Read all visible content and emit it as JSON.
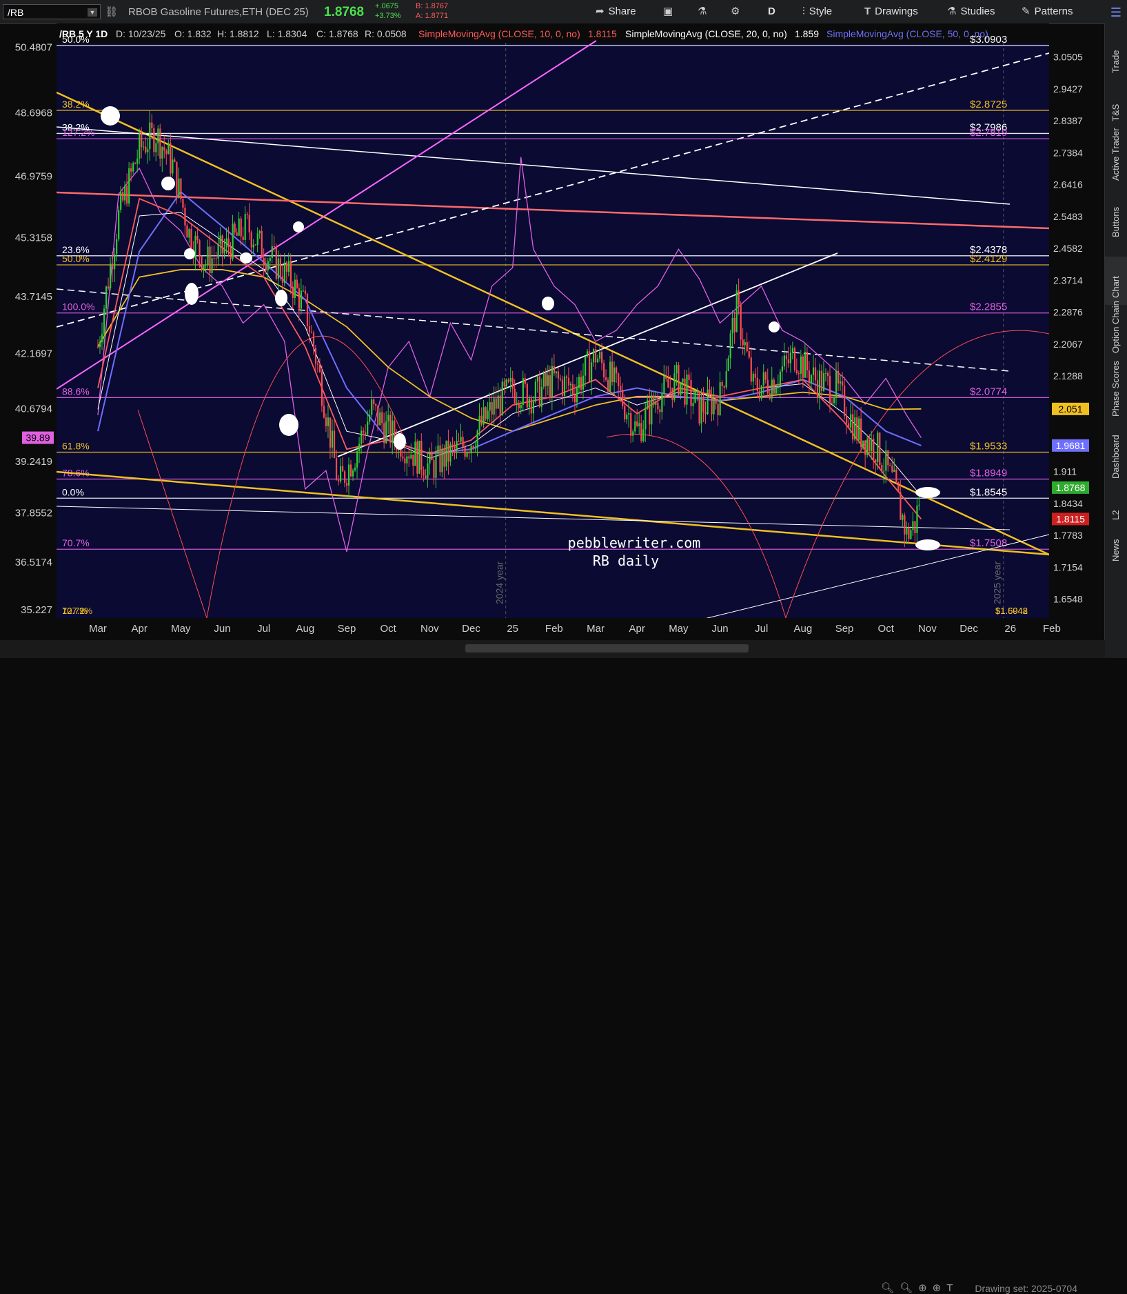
{
  "toolbar": {
    "symbol": "/RB",
    "description": "RBOB Gasoline Futures,ETH (DEC 25)",
    "last": "1.8768",
    "change": "+.0675",
    "change_pct": "+3.73%",
    "bid": "B: 1.8767",
    "ask": "A: 1.8771",
    "share": "Share",
    "timeframe": "D",
    "style": "Style",
    "drawings": "Drawings",
    "studies": "Studies",
    "patterns": "Patterns"
  },
  "header": {
    "symbol_period": "/RB 5 Y 1D",
    "date": "D: 10/23/25",
    "open": "O: 1.832",
    "high": "H: 1.8812",
    "low": "L: 1.8304",
    "close": "C: 1.8768",
    "range": "R: 0.0508",
    "sma10": "SimpleMovingAvg (CLOSE, 10, 0, no)",
    "sma10_val": "1.8115",
    "sma20": "SimpleMovingAvg (CLOSE, 20, 0, no)",
    "sma20_val": "1.859",
    "sma50": "SimpleMovingAvg (CLOSE, 50, 0, no)",
    "sma50_tail": "..."
  },
  "sidebar": {
    "tabs": [
      "Trade",
      "T&S",
      "Active Trader",
      "Buttons",
      "Chart",
      "Option Chain",
      "Phase Scores",
      "Dashboard",
      "L2",
      "News"
    ],
    "active": "Chart"
  },
  "footer": {
    "drawing_set": "Drawing set: 2025-0704"
  },
  "watermark": {
    "site": "pebblewriter.com",
    "title": "RB daily"
  },
  "colors": {
    "background": "#0a0a33",
    "price_up": "#33cc33",
    "price_down": "#ff4d4d",
    "sma10": "#ff5a5a",
    "sma20": "#ffffff",
    "sma50": "#6f6fff",
    "sma200": "#f0c020",
    "oscillator": "#e060e0",
    "fib_gold": "#f0c020",
    "fib_magenta": "#e060e0",
    "fib_white": "#ffffff"
  },
  "chart_data": {
    "type": "line",
    "x_ticks": [
      "Mar",
      "Apr",
      "May",
      "Jun",
      "Jul",
      "Aug",
      "Sep",
      "Oct",
      "Nov",
      "Dec",
      "25",
      "Feb",
      "Mar",
      "Apr",
      "May",
      "Jun",
      "Jul",
      "Aug",
      "Sep",
      "Oct",
      "Nov",
      "Dec",
      "26",
      "Feb"
    ],
    "year_markers": [
      "2024 year",
      "2025 year"
    ],
    "y_right_ticks": [
      "3.0505",
      "2.9427",
      "2.8387",
      "2.7384",
      "2.6416",
      "2.5483",
      "2.4582",
      "2.3714",
      "2.2876",
      "2.2067",
      "2.1288",
      "1.911",
      "1.8434",
      "1.7783",
      "1.7154",
      "1.6548"
    ],
    "y_left_ticks": [
      "50.4807",
      "48.6968",
      "46.9759",
      "45.3158",
      "43.7145",
      "42.1697",
      "40.6794",
      "39.2419",
      "37.8552",
      "36.5174",
      "35.227"
    ],
    "y_scale": "log",
    "y_range": [
      1.62,
      3.1
    ],
    "oscillator_range": [
      35.0,
      50.6
    ],
    "price_tags": [
      {
        "value": "2.051",
        "color": "#f0c020",
        "text": "#000000"
      },
      {
        "value": "1.9681",
        "color": "#6f6fff",
        "text": "#ffffff"
      },
      {
        "value": "1.8768",
        "color": "#2eaa2e",
        "text": "#ffffff"
      },
      {
        "value": "1.8115",
        "color": "#cc2020",
        "text": "#ffffff"
      }
    ],
    "osc_tag": {
      "value": "39.89",
      "color": "#e060e0"
    },
    "horizontal_levels": [
      {
        "price": 3.0903,
        "label": "$3.0903",
        "color": "#ffffff",
        "left_label": "50.0%"
      },
      {
        "price": 2.8725,
        "label": "$2.8725",
        "color": "#f0c020",
        "left_label": "38.2%"
      },
      {
        "price": 2.7986,
        "label": "$2.7986",
        "color": "#ffffff",
        "left_label": "38.2%"
      },
      {
        "price": 2.7819,
        "label": "$2.7819",
        "color": "#e060e0",
        "left_label": "127.2%"
      },
      {
        "price": 2.4378,
        "label": "$2.4378",
        "color": "#ffffff",
        "left_label": "23.6%"
      },
      {
        "price": 2.4129,
        "label": "$2.4129",
        "color": "#f0c020",
        "left_label": "50.0%"
      },
      {
        "price": 2.2855,
        "label": "$2.2855",
        "color": "#e060e0",
        "left_label": "100.0%"
      },
      {
        "price": 2.0774,
        "label": "$2.0774",
        "color": "#e060e0",
        "left_label": "88.6%"
      },
      {
        "price": 1.9533,
        "label": "$1.9533",
        "color": "#f0c020",
        "left_label": "61.8%"
      },
      {
        "price": 1.8949,
        "label": "$1.8949",
        "color": "#e060e0",
        "left_label": "78.6%"
      },
      {
        "price": 1.8545,
        "label": "$1.8545",
        "color": "#ffffff",
        "left_label": "0.0%"
      },
      {
        "price": 1.7508,
        "label": "$1.7508",
        "color": "#e060e0",
        "left_label": "70.7%"
      }
    ],
    "bottom_left_labels": [
      "70.7%",
      "127.2%"
    ],
    "bottom_right_labels": [
      "$1.5948",
      "$1.6042"
    ],
    "price_path": [
      [
        0,
        2.2
      ],
      [
        0.5,
        2.55
      ],
      [
        1,
        2.75
      ],
      [
        1.4,
        2.8
      ],
      [
        1.8,
        2.7
      ],
      [
        2.2,
        2.5
      ],
      [
        2.6,
        2.42
      ],
      [
        3,
        2.45
      ],
      [
        3.6,
        2.52
      ],
      [
        4,
        2.45
      ],
      [
        4.6,
        2.38
      ],
      [
        5,
        2.3
      ],
      [
        5.4,
        2.1
      ],
      [
        5.8,
        1.88
      ],
      [
        6.2,
        1.95
      ],
      [
        6.6,
        2.05
      ],
      [
        7,
        2.0
      ],
      [
        7.5,
        1.96
      ],
      [
        8,
        1.92
      ],
      [
        8.5,
        1.95
      ],
      [
        9,
        1.98
      ],
      [
        9.5,
        2.05
      ],
      [
        10,
        2.1
      ],
      [
        10.5,
        2.08
      ],
      [
        11,
        2.12
      ],
      [
        11.5,
        2.1
      ],
      [
        12,
        2.18
      ],
      [
        12.5,
        2.1
      ],
      [
        13,
        2.0
      ],
      [
        13.5,
        2.08
      ],
      [
        14,
        2.12
      ],
      [
        14.5,
        2.05
      ],
      [
        15,
        2.08
      ],
      [
        15.4,
        2.3
      ],
      [
        15.8,
        2.1
      ],
      [
        16.3,
        2.12
      ],
      [
        16.8,
        2.18
      ],
      [
        17.3,
        2.12
      ],
      [
        17.8,
        2.1
      ],
      [
        18.3,
        2.0
      ],
      [
        18.8,
        1.96
      ],
      [
        19.2,
        1.88
      ],
      [
        19.5,
        1.78
      ],
      [
        19.7,
        1.8
      ],
      [
        19.85,
        1.8768
      ]
    ],
    "oscillator_path": [
      [
        0,
        40.5
      ],
      [
        0.5,
        46.5
      ],
      [
        1,
        47.2
      ],
      [
        1.5,
        46.0
      ],
      [
        2,
        45.5
      ],
      [
        2.5,
        44.5
      ],
      [
        3,
        44.0
      ],
      [
        3.5,
        43.0
      ],
      [
        4,
        43.5
      ],
      [
        4.5,
        42.5
      ],
      [
        5,
        38.5
      ],
      [
        5.5,
        39.0
      ],
      [
        6,
        36.8
      ],
      [
        6.5,
        39.5
      ],
      [
        7,
        41.8
      ],
      [
        7.5,
        42.5
      ],
      [
        8,
        41.0
      ],
      [
        8.5,
        43.0
      ],
      [
        9,
        42.0
      ],
      [
        9.5,
        44.0
      ],
      [
        10,
        44.5
      ],
      [
        10.2,
        47.5
      ],
      [
        10.5,
        45.0
      ],
      [
        11,
        44.0
      ],
      [
        11.5,
        43.5
      ],
      [
        12,
        42.5
      ],
      [
        12.5,
        42.8
      ],
      [
        13,
        43.5
      ],
      [
        13.5,
        44.0
      ],
      [
        14,
        45.0
      ],
      [
        14.5,
        44.2
      ],
      [
        15,
        43.0
      ],
      [
        15.5,
        43.5
      ],
      [
        16,
        44.0
      ],
      [
        16.5,
        42.8
      ],
      [
        17,
        42.5
      ],
      [
        17.5,
        42.0
      ],
      [
        18,
        41.5
      ],
      [
        18.5,
        40.8
      ],
      [
        19,
        41.5
      ],
      [
        19.5,
        40.5
      ],
      [
        19.85,
        39.89
      ]
    ],
    "sma10_path": [
      [
        0,
        2.1
      ],
      [
        1,
        2.6
      ],
      [
        2,
        2.55
      ],
      [
        3,
        2.46
      ],
      [
        4,
        2.38
      ],
      [
        5,
        2.2
      ],
      [
        6,
        1.96
      ],
      [
        7,
        1.98
      ],
      [
        8,
        1.95
      ],
      [
        9,
        1.98
      ],
      [
        10,
        2.06
      ],
      [
        11,
        2.08
      ],
      [
        12,
        2.12
      ],
      [
        13,
        2.04
      ],
      [
        14,
        2.1
      ],
      [
        15,
        2.08
      ],
      [
        16,
        2.1
      ],
      [
        17,
        2.12
      ],
      [
        18,
        2.02
      ],
      [
        19,
        1.9
      ],
      [
        19.85,
        1.8115
      ]
    ],
    "sma20_path": [
      [
        0,
        2.05
      ],
      [
        1,
        2.55
      ],
      [
        2,
        2.56
      ],
      [
        3,
        2.48
      ],
      [
        4,
        2.4
      ],
      [
        5,
        2.25
      ],
      [
        6,
        2.0
      ],
      [
        7,
        1.98
      ],
      [
        8,
        1.94
      ],
      [
        9,
        1.97
      ],
      [
        10,
        2.04
      ],
      [
        11,
        2.07
      ],
      [
        12,
        2.1
      ],
      [
        13,
        2.06
      ],
      [
        14,
        2.09
      ],
      [
        15,
        2.08
      ],
      [
        16,
        2.1
      ],
      [
        17,
        2.11
      ],
      [
        18,
        2.04
      ],
      [
        19,
        1.95
      ],
      [
        19.85,
        1.859
      ]
    ],
    "sma50_path": [
      [
        0,
        2.0
      ],
      [
        1,
        2.45
      ],
      [
        2,
        2.62
      ],
      [
        3,
        2.52
      ],
      [
        4,
        2.42
      ],
      [
        5,
        2.32
      ],
      [
        6,
        2.1
      ],
      [
        7,
        1.98
      ],
      [
        8,
        1.95
      ],
      [
        9,
        1.96
      ],
      [
        10,
        2.0
      ],
      [
        11,
        2.04
      ],
      [
        12,
        2.08
      ],
      [
        13,
        2.1
      ],
      [
        14,
        2.08
      ],
      [
        15,
        2.07
      ],
      [
        16,
        2.09
      ],
      [
        17,
        2.12
      ],
      [
        18,
        2.08
      ],
      [
        19,
        2.0
      ],
      [
        19.85,
        1.9681
      ]
    ],
    "sma100_path": [
      [
        0,
        2.2
      ],
      [
        1,
        2.38
      ],
      [
        2,
        2.4
      ],
      [
        3,
        2.4
      ],
      [
        4,
        2.38
      ],
      [
        5,
        2.32
      ],
      [
        6,
        2.25
      ],
      [
        7,
        2.15
      ],
      [
        8,
        2.08
      ],
      [
        9,
        2.03
      ],
      [
        10,
        2.0
      ],
      [
        11,
        2.03
      ],
      [
        12,
        2.06
      ],
      [
        13,
        2.08
      ],
      [
        14,
        2.08
      ],
      [
        15,
        2.07
      ],
      [
        16,
        2.08
      ],
      [
        17,
        2.09
      ],
      [
        18,
        2.08
      ],
      [
        19,
        2.05
      ],
      [
        19.85,
        2.051
      ]
    ]
  }
}
